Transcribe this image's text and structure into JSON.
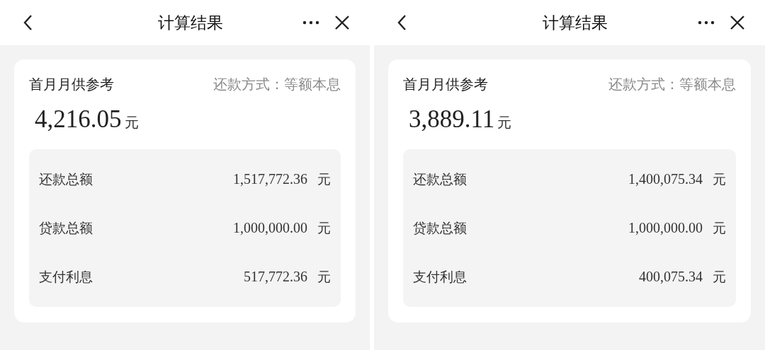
{
  "screens": [
    {
      "title": "计算结果",
      "card": {
        "label": "首月月供参考",
        "method": "还款方式：等额本息",
        "amount": "4,216.05",
        "unit": "元",
        "rows": [
          {
            "label": "还款总额",
            "value": "1,517,772.36",
            "unit": "元"
          },
          {
            "label": "贷款总额",
            "value": "1,000,000.00",
            "unit": "元"
          },
          {
            "label": "支付利息",
            "value": "517,772.36",
            "unit": "元"
          }
        ]
      }
    },
    {
      "title": "计算结果",
      "card": {
        "label": "首月月供参考",
        "method": "还款方式：等额本息",
        "amount": "3,889.11",
        "unit": "元",
        "rows": [
          {
            "label": "还款总额",
            "value": "1,400,075.34",
            "unit": "元"
          },
          {
            "label": "贷款总额",
            "value": "1,000,000.00",
            "unit": "元"
          },
          {
            "label": "支付利息",
            "value": "400,075.34",
            "unit": "元"
          }
        ]
      }
    }
  ]
}
